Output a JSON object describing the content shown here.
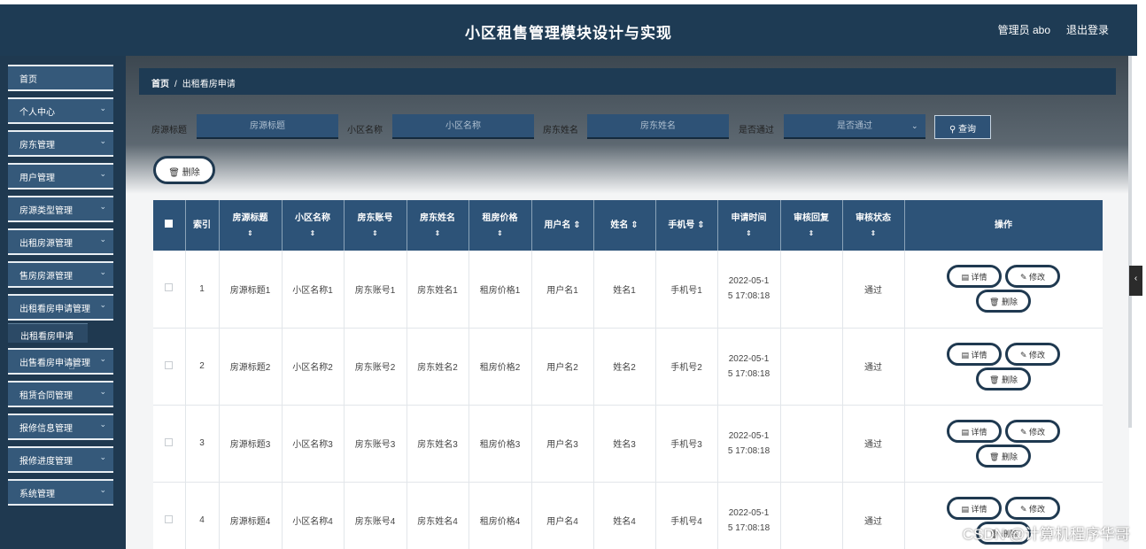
{
  "header": {
    "title": "小区租售管理模块设计与实现",
    "user": "管理员 abo",
    "logout": "退出登录"
  },
  "sidebar": {
    "items": [
      {
        "label": "首页",
        "chevron": false
      },
      {
        "label": "个人中心",
        "chevron": true
      },
      {
        "label": "房东管理",
        "chevron": true
      },
      {
        "label": "用户管理",
        "chevron": true
      },
      {
        "label": "房源类型管理",
        "chevron": true
      },
      {
        "label": "出租房源管理",
        "chevron": true
      },
      {
        "label": "售房房源管理",
        "chevron": true
      },
      {
        "label": "出租看房申请管理",
        "chevron": true
      },
      {
        "label": "出售看房申请管理",
        "chevron": true
      },
      {
        "label": "租赁合同管理",
        "chevron": true
      },
      {
        "label": "报修信息管理",
        "chevron": true
      },
      {
        "label": "报修进度管理",
        "chevron": true
      },
      {
        "label": "系统管理",
        "chevron": true
      }
    ],
    "sub_item": "出租看房申请"
  },
  "breadcrumb": {
    "home": "首页",
    "separator": "/",
    "current": "出租看房申请"
  },
  "search": {
    "title_label": "房源标题",
    "title_placeholder": "房源标题",
    "community_label": "小区名称",
    "community_placeholder": "小区名称",
    "landlord_label": "房东姓名",
    "landlord_placeholder": "房东姓名",
    "approved_label": "是否通过",
    "approved_placeholder": "是否通过",
    "query_label": "查询"
  },
  "delete_label": "删除",
  "table": {
    "headers": [
      "索引",
      "房源标题",
      "小区名称",
      "房东账号",
      "房东姓名",
      "租房价格",
      "用户名",
      "姓名",
      "手机号",
      "申请时间",
      "审核回复",
      "审核状态",
      "操作"
    ],
    "sort_mark": "⇕",
    "rows": [
      [
        "1",
        "房源标题1",
        "小区名称1",
        "房东账号1",
        "房东姓名1",
        "租房价格1",
        "用户名1",
        "姓名1",
        "手机号1",
        "2022-05-1",
        "5 17:08:18",
        "",
        "通过"
      ],
      [
        "2",
        "房源标题2",
        "小区名称2",
        "房东账号2",
        "房东姓名2",
        "租房价格2",
        "用户名2",
        "姓名2",
        "手机号2",
        "2022-05-1",
        "5 17:08:18",
        "",
        "通过"
      ],
      [
        "3",
        "房源标题3",
        "小区名称3",
        "房东账号3",
        "房东姓名3",
        "租房价格3",
        "用户名3",
        "姓名3",
        "手机号3",
        "2022-05-1",
        "5 17:08:18",
        "",
        "通过"
      ],
      [
        "4",
        "房源标题4",
        "小区名称4",
        "房东账号4",
        "房东姓名4",
        "租房价格4",
        "用户名4",
        "姓名4",
        "手机号4",
        "2022-05-1",
        "5 17:08:18",
        "",
        "通过"
      ]
    ],
    "actions": {
      "detail": "详情",
      "edit": "修改",
      "delete": "删除"
    }
  },
  "watermark": "CSDN @计算机程序华哥",
  "colors": {
    "primary": "#1e3b54",
    "button": "#2e5276",
    "menu": "#35597a"
  }
}
